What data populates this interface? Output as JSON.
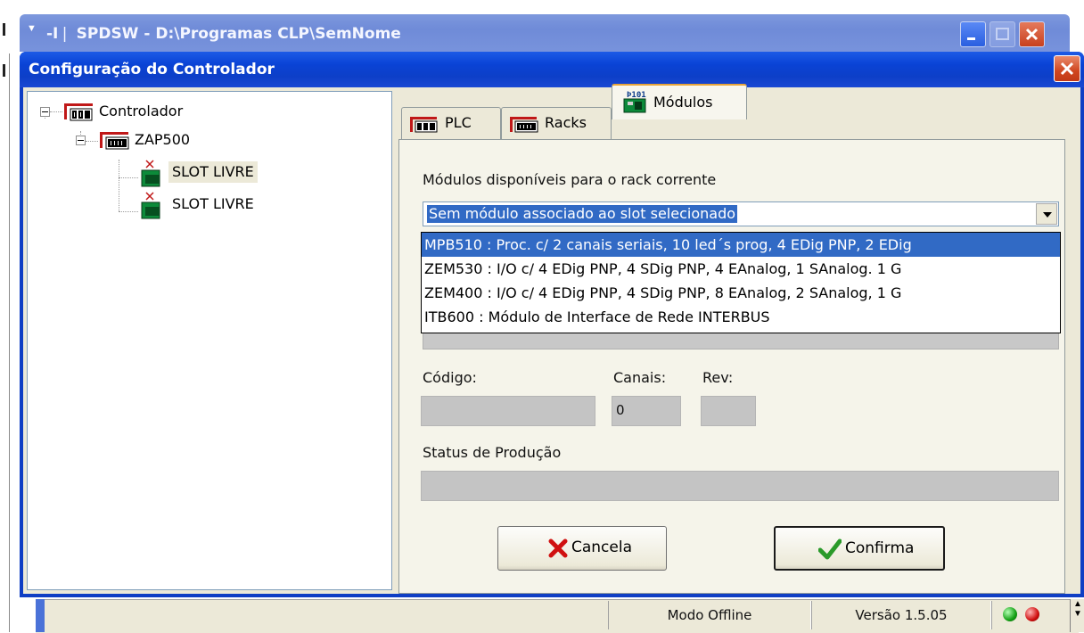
{
  "app": {
    "title": "SPDSW - D:\\Programas CLP\\SemNome",
    "logo": "-I❘"
  },
  "dialog": {
    "title": "Configuração do Controlador"
  },
  "tree": {
    "root": "Controlador",
    "rack": "ZAP500",
    "slots": [
      "SLOT LIVRE",
      "SLOT LIVRE"
    ]
  },
  "tabs": [
    {
      "label": "PLC",
      "icon": "plc-icon"
    },
    {
      "label": "Racks",
      "icon": "rack-icon"
    },
    {
      "label": "Módulos",
      "icon": "module-icon",
      "active": true
    }
  ],
  "modules": {
    "available_label": "Módulos disponíveis para o rack corrente",
    "selected_value": "Sem módulo associado ao slot selecionado",
    "options": [
      "MPB510 : Proc. c/ 2 canais seriais, 10 led´s prog, 4 EDig PNP, 2 EDig",
      "ZEM530 : I/O c/ 4 EDig PNP, 4 SDig PNP, 4 EAnalog, 1 SAnalog. 1 G",
      "ZEM400 : I/O c/ 4 EDig PNP, 4 SDig PNP, 8 EAnalog, 2 SAnalog, 1 G",
      "ITB600 : Módulo de Interface de Rede INTERBUS"
    ],
    "highlighted_index": 0,
    "codigo_label": "Código:",
    "canais_label": "Canais:",
    "canais_value": "0",
    "rev_label": "Rev:",
    "status_label": "Status de Produção"
  },
  "buttons": {
    "cancel": "Cancela",
    "confirm": "Confirma"
  },
  "statusbar": {
    "mode": "Modo Offline",
    "version": "Versão 1.5.05"
  },
  "colors": {
    "titlebar": "#0a43d6",
    "selection": "#316ac5",
    "dialog_bg": "#ece9d8",
    "cancel_icon": "#d01010",
    "confirm_icon": "#2a9a2a"
  }
}
